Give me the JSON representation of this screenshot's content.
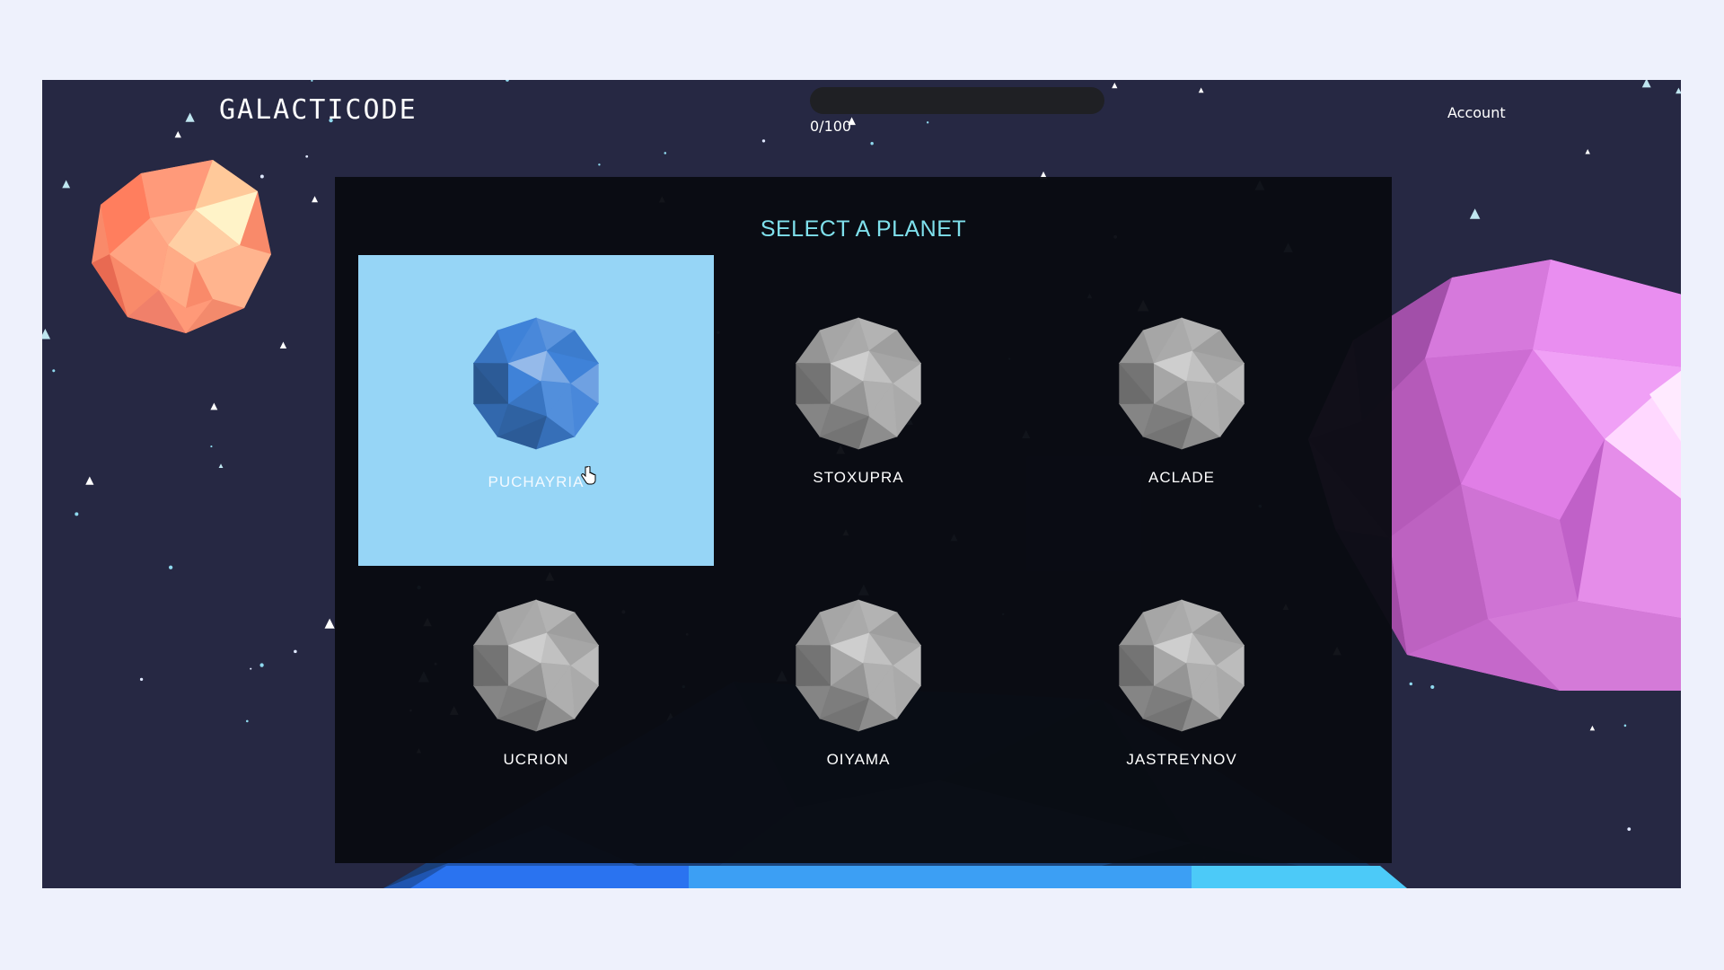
{
  "app": {
    "logo": "GALACTICODE",
    "account_label": "Account"
  },
  "progress": {
    "label": "0/100",
    "value": 0,
    "max": 100
  },
  "panel": {
    "title": "SELECT A PLANET"
  },
  "planets": [
    {
      "name": "PUCHAYRIA",
      "selected": true,
      "color": "#3f82d8"
    },
    {
      "name": "STOXUPRA",
      "selected": false,
      "color": "#a6a6a6"
    },
    {
      "name": "ACLADE",
      "selected": false,
      "color": "#a6a6a6"
    },
    {
      "name": "UCRION",
      "selected": false,
      "color": "#a6a6a6"
    },
    {
      "name": "OIYAMA",
      "selected": false,
      "color": "#a6a6a6"
    },
    {
      "name": "JASTREYNOV",
      "selected": false,
      "color": "#a6a6a6"
    }
  ],
  "colors": {
    "background": "#262843",
    "selected_card": "#96d5f6",
    "title": "#7fe0ec",
    "orange_planet": "#ff8a6e",
    "pink_planet": "#d468d8",
    "ground": "#2f8cf2"
  }
}
